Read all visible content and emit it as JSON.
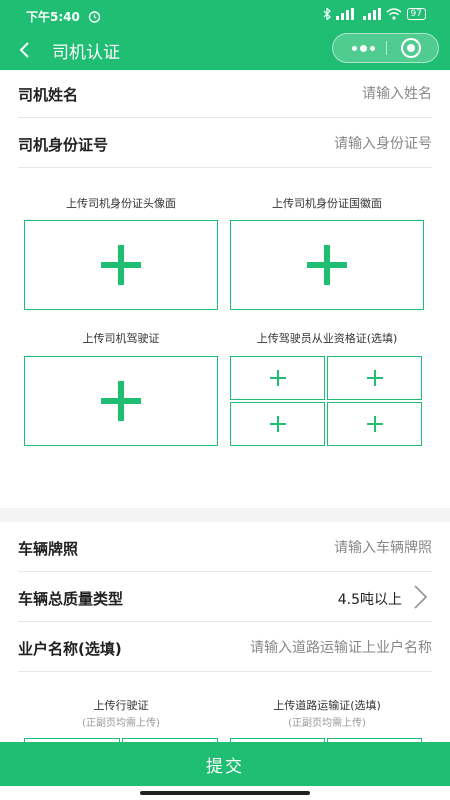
{
  "statusbar": {
    "time": "下午5:40",
    "battery": "97"
  },
  "navbar": {
    "title": "司机认证"
  },
  "driver_section": {
    "name_label": "司机姓名",
    "name_placeholder": "请输入姓名",
    "id_label": "司机身份证号",
    "id_placeholder": "请输入身份证号",
    "uploads": {
      "id_front": "上传司机身份证头像面",
      "id_back": "上传司机身份证国徽面",
      "license": "上传司机驾驶证",
      "qualification": "上传驾驶员从业资格证(选填)"
    }
  },
  "vehicle_section": {
    "plate_label": "车辆牌照",
    "plate_placeholder": "请输入车辆牌照",
    "weight_label": "车辆总质量类型",
    "weight_value": "4.5吨以上",
    "owner_label": "业户名称(选填)",
    "owner_placeholder": "请输入道路运输证上业户名称",
    "uploads": {
      "vehicle_license": "上传行驶证",
      "vehicle_license_sub": "(正副页均需上传)",
      "transport_permit": "上传道路运输证(选填)",
      "transport_permit_sub": "(正副页均需上传)"
    }
  },
  "submit_label": "提交",
  "colors": {
    "primary": "#1fbe73"
  }
}
